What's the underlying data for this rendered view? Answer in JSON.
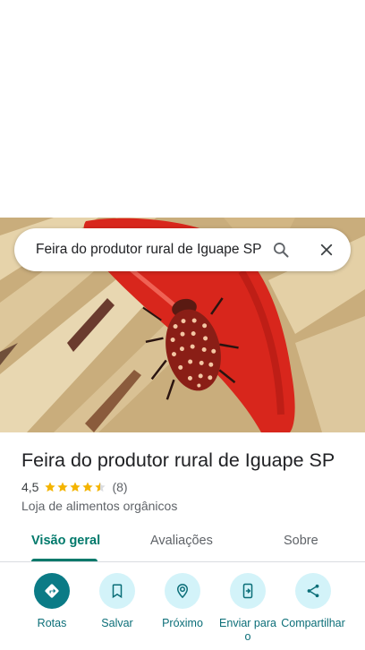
{
  "search": {
    "query": "Feira do produtor rural de Iguape SP",
    "search_icon": "search-icon",
    "close_icon": "close-icon"
  },
  "hero_image": {
    "description_icon": "place-photo"
  },
  "place": {
    "title": "Feira do produtor rural de Iguape SP",
    "rating": "4,5",
    "stars_value": 4.5,
    "review_count": "(8)",
    "category": "Loja de alimentos orgânicos"
  },
  "tabs": [
    {
      "label": "Visão geral",
      "active": true
    },
    {
      "label": "Avaliações",
      "active": false
    },
    {
      "label": "Sobre",
      "active": false
    }
  ],
  "actions": [
    {
      "label": "Rotas",
      "icon": "directions-icon",
      "primary": true
    },
    {
      "label": "Salvar",
      "icon": "bookmark-icon",
      "primary": false
    },
    {
      "label": "Próximo",
      "icon": "nearby-icon",
      "primary": false
    },
    {
      "label": "Enviar para o",
      "icon": "send-to-phone-icon",
      "primary": false
    },
    {
      "label": "Compartilhar",
      "icon": "share-icon",
      "primary": false
    }
  ],
  "colors": {
    "accent": "#00796b",
    "star": "#f4b400",
    "action_bg": "#d3f3f9",
    "action_primary": "#0b7b86"
  }
}
